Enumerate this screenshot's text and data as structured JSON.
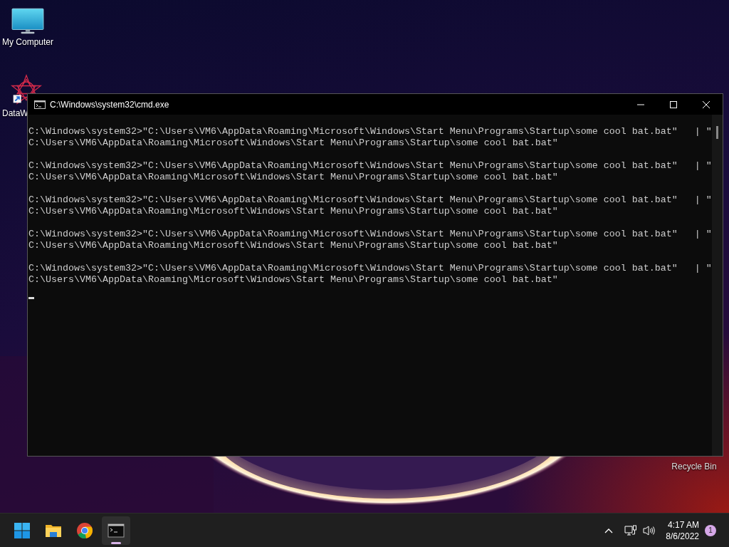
{
  "desktop": {
    "icons": [
      {
        "kind": "computer",
        "label": "My Computer"
      },
      {
        "kind": "app",
        "label": "DataW"
      },
      {
        "kind": "bin",
        "label": "Recycle Bin"
      }
    ]
  },
  "window": {
    "title": "C:\\Windows\\system32\\cmd.exe",
    "commands": [
      {
        "lines": [
          "C:\\Windows\\system32>\"C:\\Users\\VM6\\AppData\\Roaming\\Microsoft\\Windows\\Start Menu\\Programs\\Startup\\some cool bat.bat\"   | \"",
          "C:\\Users\\VM6\\AppData\\Roaming\\Microsoft\\Windows\\Start Menu\\Programs\\Startup\\some cool bat.bat\""
        ]
      },
      {
        "lines": [
          "C:\\Windows\\system32>\"C:\\Users\\VM6\\AppData\\Roaming\\Microsoft\\Windows\\Start Menu\\Programs\\Startup\\some cool bat.bat\"   | \"",
          "C:\\Users\\VM6\\AppData\\Roaming\\Microsoft\\Windows\\Start Menu\\Programs\\Startup\\some cool bat.bat\""
        ]
      },
      {
        "lines": [
          "C:\\Windows\\system32>\"C:\\Users\\VM6\\AppData\\Roaming\\Microsoft\\Windows\\Start Menu\\Programs\\Startup\\some cool bat.bat\"   | \"",
          "C:\\Users\\VM6\\AppData\\Roaming\\Microsoft\\Windows\\Start Menu\\Programs\\Startup\\some cool bat.bat\""
        ]
      },
      {
        "lines": [
          "C:\\Windows\\system32>\"C:\\Users\\VM6\\AppData\\Roaming\\Microsoft\\Windows\\Start Menu\\Programs\\Startup\\some cool bat.bat\"   | \"",
          "C:\\Users\\VM6\\AppData\\Roaming\\Microsoft\\Windows\\Start Menu\\Programs\\Startup\\some cool bat.bat\""
        ]
      },
      {
        "lines": [
          "C:\\Windows\\system32>\"C:\\Users\\VM6\\AppData\\Roaming\\Microsoft\\Windows\\Start Menu\\Programs\\Startup\\some cool bat.bat\"   | \"",
          "C:\\Users\\VM6\\AppData\\Roaming\\Microsoft\\Windows\\Start Menu\\Programs\\Startup\\some cool bat.bat\""
        ]
      }
    ],
    "cursor_visible": true
  },
  "taskbar": {
    "apps": [
      {
        "kind": "start",
        "selected": false
      },
      {
        "kind": "folder",
        "selected": false
      },
      {
        "kind": "browser",
        "selected": false
      },
      {
        "kind": "terminal",
        "selected": true
      }
    ],
    "time": "4:17 AM",
    "date": "8/6/2022",
    "notification_count": "1"
  }
}
